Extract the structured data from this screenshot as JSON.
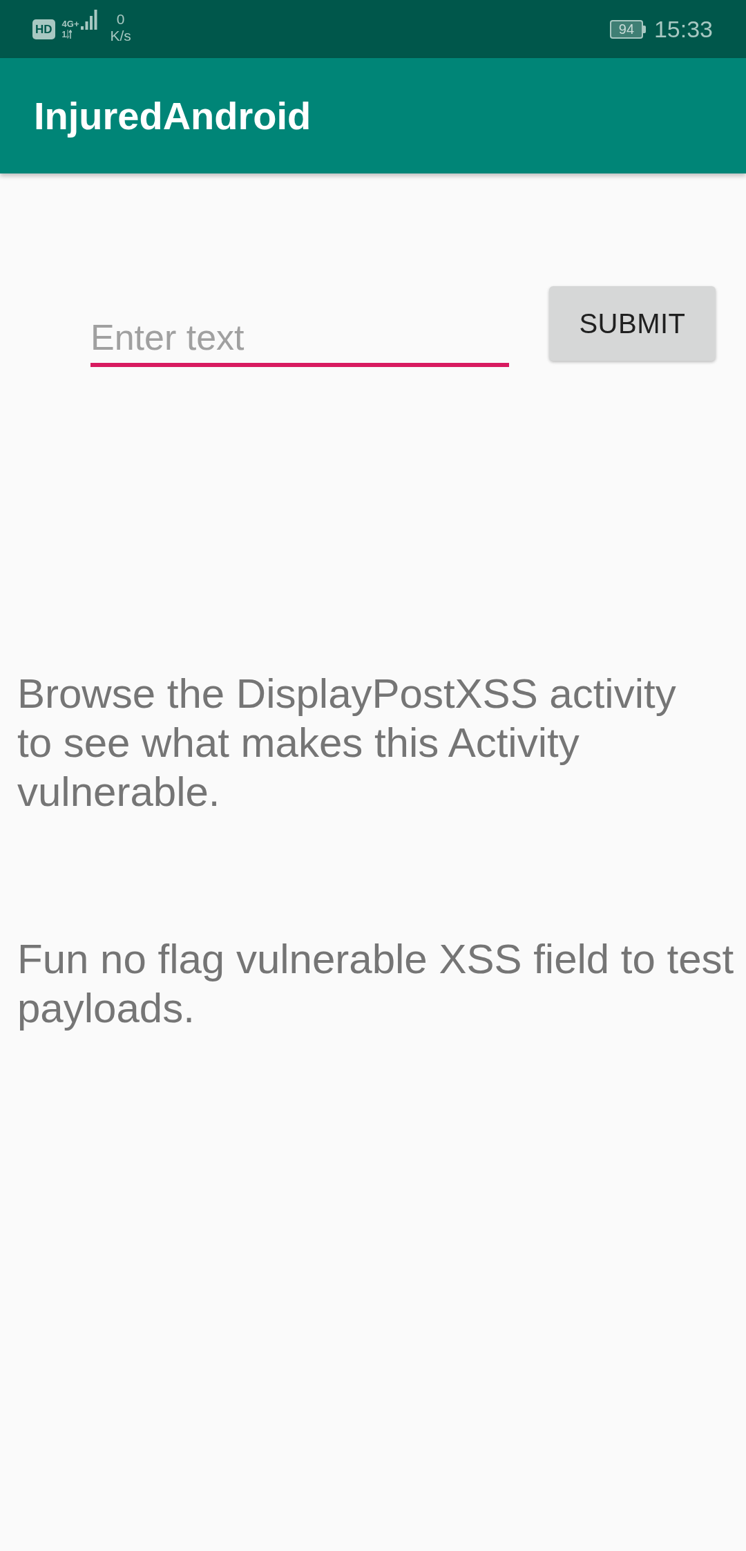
{
  "status_bar": {
    "hd_badge": "HD",
    "network_type": "4G+",
    "sim_number": "1",
    "net_speed_value": "0",
    "net_speed_unit": "K/s",
    "battery_percent": "94",
    "time": "15:33"
  },
  "app_bar": {
    "title": "InjuredAndroid"
  },
  "form": {
    "text_field": {
      "placeholder": "Enter text",
      "focused": true
    },
    "submit_button": "SUBMIT"
  },
  "paragraphs": [
    "Browse the DisplayPostXSS activity to see what makes this Activity vulnerable.",
    "Fun no flag vulnerable XSS field to test payloads."
  ]
}
